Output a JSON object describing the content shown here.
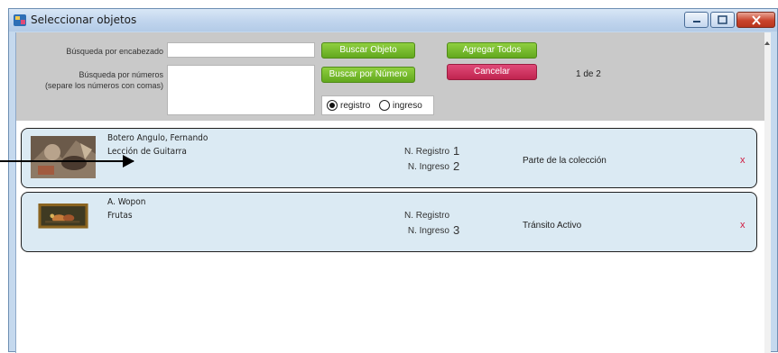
{
  "window": {
    "title": "Seleccionar objetos"
  },
  "search": {
    "header_label": "Búsqueda por encabezado",
    "header_value": "",
    "numbers_label_line1": "Búsqueda por números",
    "numbers_label_line2": "(separe los números con comas)",
    "numbers_value": "",
    "search_object_btn": "Buscar Objeto",
    "search_number_btn": "Buscar por Número",
    "add_all_btn": "Agregar Todos",
    "cancel_btn": "Cancelar",
    "radio_registro": "registro",
    "radio_ingreso": "ingreso",
    "radio_selected": "registro",
    "pager": "1 de 2"
  },
  "results": [
    {
      "artist": "Botero Angulo, Fernando",
      "title": "Lección de Guitarra",
      "registro_label": "N. Registro",
      "registro_value": "1",
      "ingreso_label": "N. Ingreso",
      "ingreso_value": "2",
      "status": "Parte de la colección",
      "remove": "x"
    },
    {
      "artist": "A. Wopon",
      "title": "Frutas",
      "registro_label": "N. Registro",
      "registro_value": "",
      "ingreso_label": "N. Ingreso",
      "ingreso_value": "3",
      "status": "Tránsito Activo",
      "remove": "x"
    }
  ],
  "colors": {
    "green_button": "#62a81e",
    "red_button": "#c0244f",
    "card_background": "#dbeaf3",
    "remove_x": "#d0183e"
  }
}
